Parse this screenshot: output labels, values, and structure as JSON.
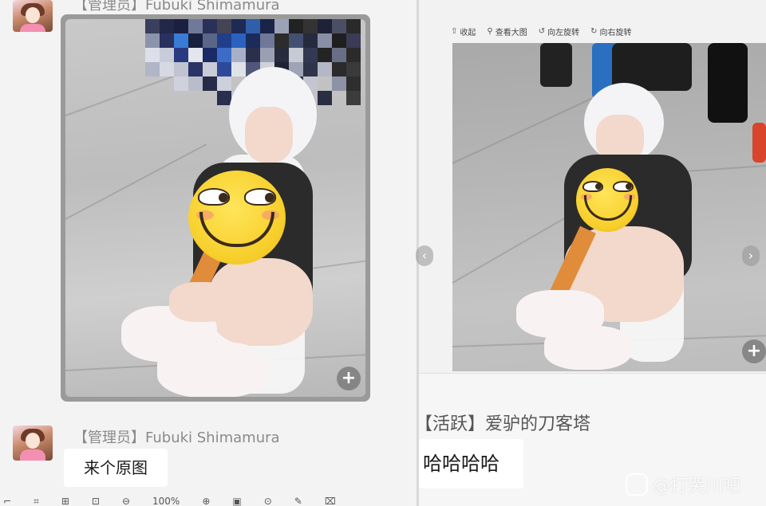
{
  "chat": {
    "sender_top": "【管理员】Fubuki Shimamura",
    "sender_bottom": "【管理员】Fubuki Shimamura",
    "message_text": "来个原图"
  },
  "viewer": {
    "toolbar": [
      {
        "icon": "collect-icon",
        "glyph": "⇧",
        "label": "收起"
      },
      {
        "icon": "view-large-icon",
        "glyph": "⚲",
        "label": "查看大图"
      },
      {
        "icon": "rotate-left-icon",
        "glyph": "↺",
        "label": "向左旋转"
      },
      {
        "icon": "rotate-right-icon",
        "glyph": "↻",
        "label": "向右旋转"
      }
    ],
    "prev_glyph": "‹",
    "next_glyph": "›",
    "zoom_glyph": "+"
  },
  "reply": {
    "user_label": "【活跃】爱驴的刀客塔",
    "message_text": "哈哈哈哈"
  },
  "watermark": {
    "text": "@打哭川吧"
  },
  "bottom_toolbar": {
    "zoom_level": "100%"
  },
  "colors": {
    "emoji_yellow": "#f7cf2c",
    "chat_background": "#f3f3f3",
    "bubble_background": "#ffffff"
  }
}
